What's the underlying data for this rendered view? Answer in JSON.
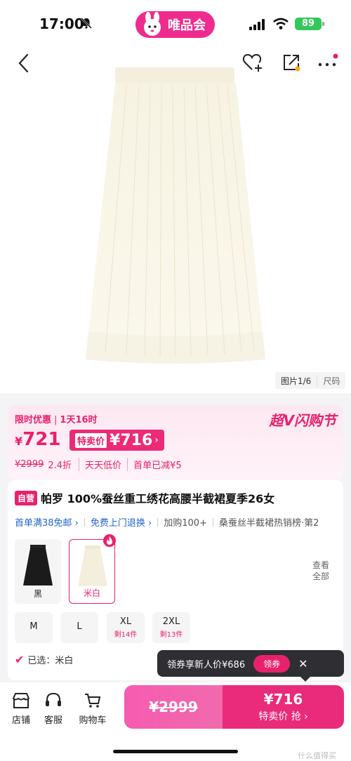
{
  "status": {
    "time": "17:00",
    "app_badge": "唯品会",
    "battery": "89"
  },
  "gallery": {
    "counter": "图片1/6",
    "size_tag": "尺码"
  },
  "price": {
    "promo_label": "限时优惠",
    "countdown": "1天16时",
    "flash_sale": "超V闪购节",
    "yen": "¥",
    "final_price": "721",
    "special_label": "特卖价",
    "special_price": "¥716",
    "original": "¥2999",
    "discount": "2.4折",
    "chip1": "天天低价",
    "chip2": "首单已减¥5"
  },
  "product": {
    "self_tag": "自营",
    "title": "帕罗 100%蚕丝重工绣花高腰半截裙夏季26女",
    "services": [
      "首单满38免邮",
      "免费上门退换",
      "加购100+",
      "桑蚕丝半截裙热销榜·第2"
    ],
    "colors": [
      {
        "name": "黑",
        "selected": false
      },
      {
        "name": "米白",
        "selected": true
      }
    ],
    "view_all": [
      "查看",
      "全部"
    ],
    "sizes": [
      {
        "size": "M",
        "left": ""
      },
      {
        "size": "L",
        "left": ""
      },
      {
        "size": "XL",
        "left": "剩14件"
      },
      {
        "size": "2XL",
        "left": "剩13件"
      }
    ],
    "selected": "已选：米白"
  },
  "coupon": {
    "text": "领券享新人价¥686",
    "button": "领券",
    "close": "✕"
  },
  "bottom": {
    "tabs": [
      "店铺",
      "客服",
      "购物车"
    ],
    "orig_price": "¥2999",
    "buy_price": "¥716",
    "buy_label": "特卖价 抢 ›"
  },
  "watermark": "什么值得买",
  "colors": {
    "brand": "#e8216d",
    "link": "#2267c9"
  }
}
